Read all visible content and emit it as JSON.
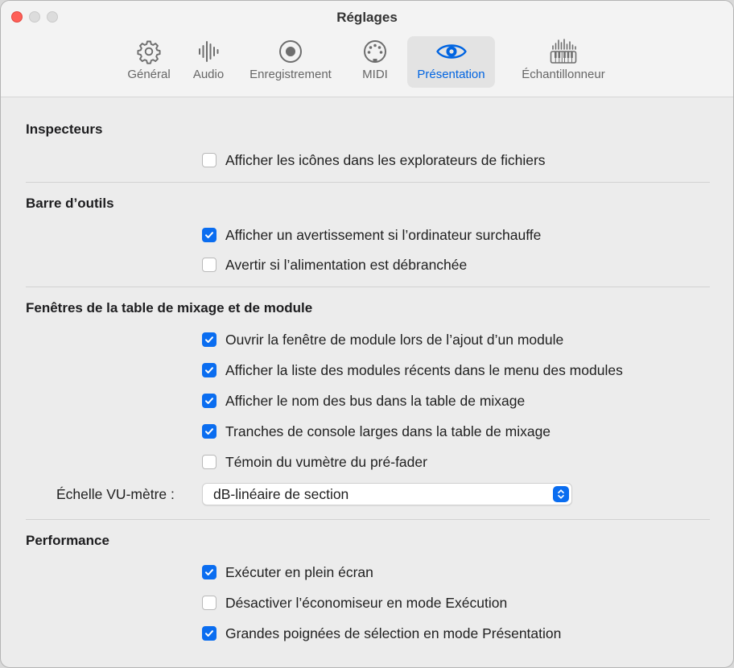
{
  "window": {
    "title": "Réglages"
  },
  "tabs": [
    {
      "label": "Général",
      "icon": "gear-icon"
    },
    {
      "label": "Audio",
      "icon": "waveform-icon"
    },
    {
      "label": "Enregistrement",
      "icon": "record-icon"
    },
    {
      "label": "MIDI",
      "icon": "midi-connector-icon"
    },
    {
      "label": "Présentation",
      "icon": "eye-icon",
      "selected": true
    },
    {
      "label": "Échantillonneur",
      "icon": "sampler-keyboard-icon"
    }
  ],
  "colors": {
    "accent": "#0a6df0",
    "close": "#fe5f57",
    "selected_tab_text": "#0064e1"
  },
  "sections": {
    "inspecteurs": {
      "title": "Inspecteurs",
      "items": [
        {
          "label": "Afficher les icônes dans les explorateurs de fichiers",
          "checked": false
        }
      ]
    },
    "barre": {
      "title": "Barre d’outils",
      "items": [
        {
          "label": "Afficher un avertissement si l’ordinateur surchauffe",
          "checked": true
        },
        {
          "label": "Avertir si l’alimentation est débranchée",
          "checked": false
        }
      ]
    },
    "fenetres": {
      "title": "Fenêtres de la table de mixage et de module",
      "items": [
        {
          "label": "Ouvrir la fenêtre de module lors de l’ajout d’un module",
          "checked": true
        },
        {
          "label": "Afficher la liste des modules récents dans le menu des modules",
          "checked": true
        },
        {
          "label": "Afficher le nom des bus dans la table de mixage",
          "checked": true
        },
        {
          "label": "Tranches de console larges dans la table de mixage",
          "checked": true
        },
        {
          "label": "Témoin du vumètre du pré-fader",
          "checked": false
        }
      ],
      "vu_label": "Échelle VU-mètre :",
      "vu_value": "dB-linéaire de section"
    },
    "performance": {
      "title": "Performance",
      "items": [
        {
          "label": "Exécuter en plein écran",
          "checked": true
        },
        {
          "label": "Désactiver l’économiseur en mode Exécution",
          "checked": false
        },
        {
          "label": "Grandes poignées de sélection en mode Présentation",
          "checked": true
        }
      ]
    }
  }
}
